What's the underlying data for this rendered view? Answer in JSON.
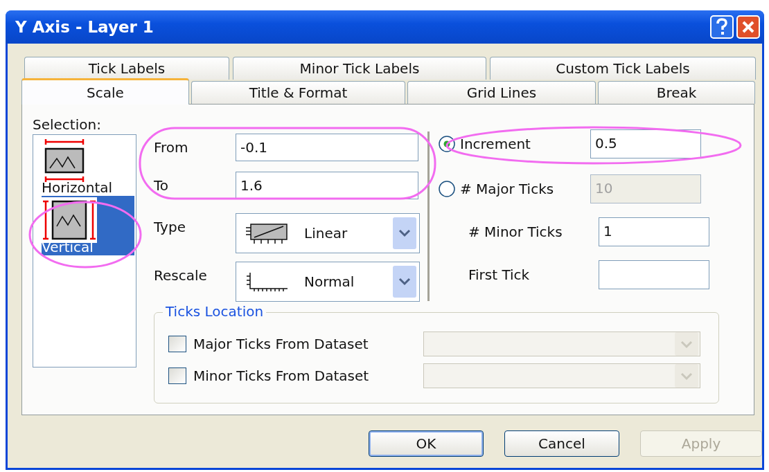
{
  "window": {
    "title": "Y Axis - Layer 1"
  },
  "tab_rows": [
    [
      {
        "label": "Tick Labels",
        "selected": false
      },
      {
        "label": "Minor Tick Labels",
        "selected": false
      },
      {
        "label": "Custom Tick Labels",
        "selected": false
      }
    ],
    [
      {
        "label": "Scale",
        "selected": true
      },
      {
        "label": "Title & Format",
        "selected": false
      },
      {
        "label": "Grid Lines",
        "selected": false
      },
      {
        "label": "Break",
        "selected": false
      }
    ]
  ],
  "selection": {
    "label": "Selection:",
    "items": [
      {
        "label": "Horizontal",
        "kind": "horizontal",
        "selected": false
      },
      {
        "label": "Vertical",
        "kind": "vertical",
        "selected": true
      }
    ]
  },
  "range": [
    {
      "label": "From",
      "value": "-0.1"
    },
    {
      "label": "To",
      "value": "1.6"
    }
  ],
  "dropdowns": [
    {
      "label": "Type",
      "kind": "linear",
      "value": "Linear"
    },
    {
      "label": "Rescale",
      "kind": "axis",
      "value": "Normal"
    }
  ],
  "ticks": [
    {
      "kind": "radio",
      "label": "Increment",
      "selected": true,
      "value": "0.5",
      "disabled": false
    },
    {
      "kind": "radio",
      "label": "# Major Ticks",
      "selected": false,
      "value": "10",
      "disabled": true
    },
    {
      "kind": "plain",
      "label": "# Minor Ticks",
      "value": "1",
      "disabled": false
    },
    {
      "kind": "plain",
      "label": "First Tick",
      "disabled": false
    }
  ],
  "ticks_location": {
    "title": "Ticks Location",
    "rows": [
      {
        "label": "Major Ticks From Dataset",
        "checked": false
      },
      {
        "label": "Minor Ticks From Dataset",
        "checked": false
      }
    ]
  },
  "buttons": [
    {
      "label": "OK",
      "disabled": false
    },
    {
      "label": "Cancel",
      "disabled": false
    },
    {
      "label": "Apply",
      "disabled": true
    }
  ]
}
